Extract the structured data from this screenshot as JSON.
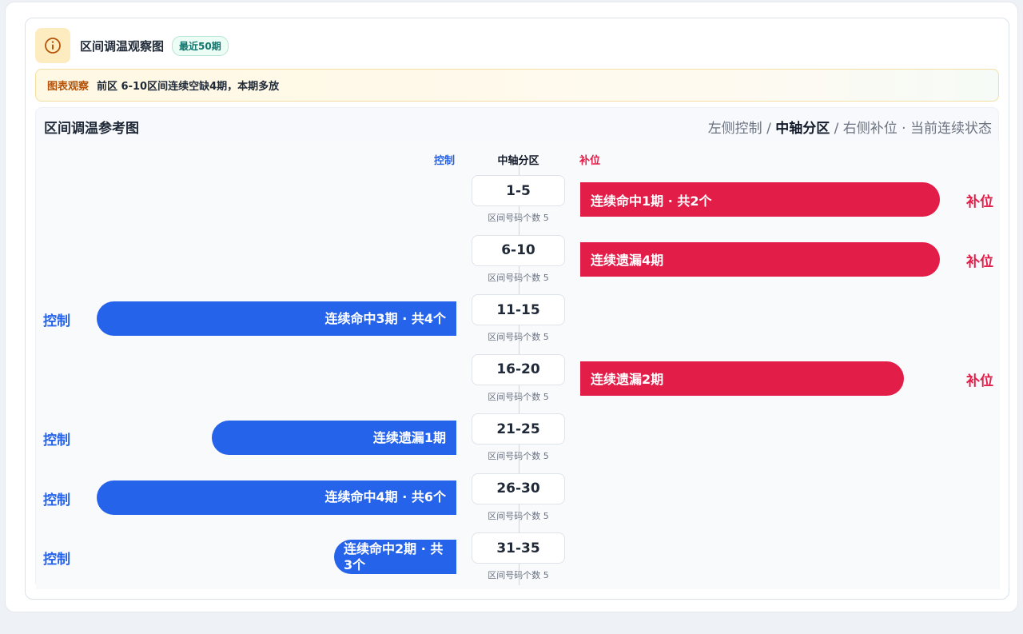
{
  "header": {
    "title": "区间调温观察图",
    "badge": "最近50期",
    "icon": "info-icon"
  },
  "observation": {
    "label": "图表观察",
    "text": "前区 6-10区间连续空缺4期，本期多放"
  },
  "panel": {
    "title": "区间调温参考图",
    "legend": {
      "left": "左侧控制",
      "sep1": " / ",
      "center": "中轴分区",
      "sep2": " / ",
      "right": "右侧补位",
      "dot": " · ",
      "state": "当前连续状态"
    },
    "column_heads": {
      "left": "控制",
      "center": "中轴分区",
      "right": "补位"
    }
  },
  "colors": {
    "control": "#2563eb",
    "fill": "#e11d48"
  },
  "rows": [
    {
      "range": "1-5",
      "sub": "区间号码个数 5",
      "side": "right",
      "text": "连续命中1期 · 共2个",
      "label": "补位",
      "length": 450
    },
    {
      "range": "6-10",
      "sub": "区间号码个数 5",
      "side": "right",
      "text": "连续遗漏4期",
      "label": "补位",
      "length": 450
    },
    {
      "range": "11-15",
      "sub": "区间号码个数 5",
      "side": "left",
      "text": "连续命中3期 · 共4个",
      "label": "控制",
      "length": 450
    },
    {
      "range": "16-20",
      "sub": "区间号码个数 5",
      "side": "right",
      "text": "连续遗漏2期",
      "label": "补位",
      "length": 405
    },
    {
      "range": "21-25",
      "sub": "区间号码个数 5",
      "side": "left",
      "text": "连续遗漏1期",
      "label": "控制",
      "length": 306
    },
    {
      "range": "26-30",
      "sub": "区间号码个数 5",
      "side": "left",
      "text": "连续命中4期 · 共6个",
      "label": "控制",
      "length": 450
    },
    {
      "range": "31-35",
      "sub": "区间号码个数 5",
      "side": "left",
      "text": "连续命中2期 · 共3个",
      "label": "控制",
      "length": 153
    }
  ]
}
